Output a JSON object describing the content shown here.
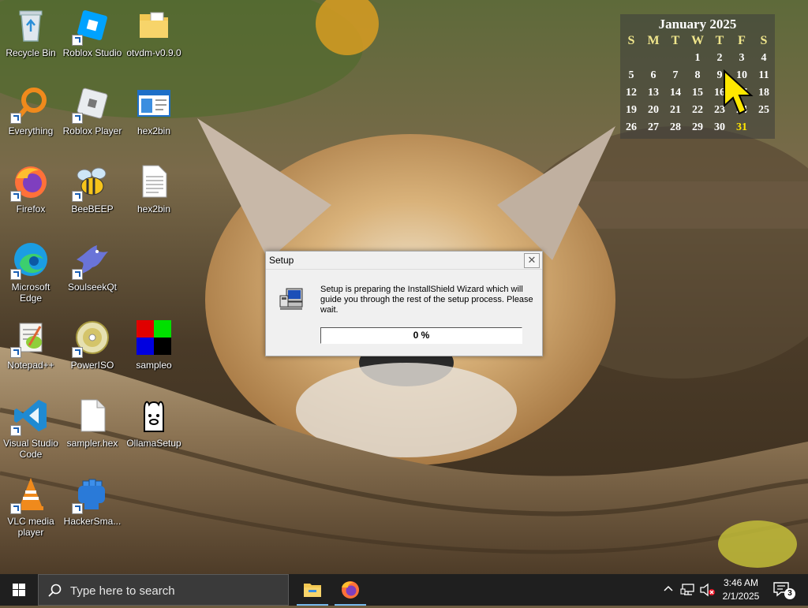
{
  "desktop": {
    "icons": [
      {
        "label": "Recycle Bin",
        "icon": "recycle-bin-icon"
      },
      {
        "label": "Roblox Studio",
        "icon": "roblox-studio-icon"
      },
      {
        "label": "otvdm-v0.9.0",
        "icon": "folder-icon"
      },
      {
        "label": "Everything",
        "icon": "everything-search-icon"
      },
      {
        "label": "Roblox Player",
        "icon": "roblox-player-icon"
      },
      {
        "label": "hex2bin",
        "icon": "window-app-icon"
      },
      {
        "label": "Firefox",
        "icon": "firefox-icon"
      },
      {
        "label": "BeeBEEP",
        "icon": "bee-icon"
      },
      {
        "label": "hex2bin",
        "icon": "text-file-icon"
      },
      {
        "label": "Microsoft Edge",
        "icon": "edge-icon"
      },
      {
        "label": "SoulseekQt",
        "icon": "bird-icon"
      },
      {
        "label": "Notepad++",
        "icon": "notepadpp-icon"
      },
      {
        "label": "PowerISO",
        "icon": "disc-icon"
      },
      {
        "label": "sampleo",
        "icon": "color-grid-icon"
      },
      {
        "label": "Visual Studio Code",
        "icon": "vscode-icon"
      },
      {
        "label": "sampler.hex",
        "icon": "blank-file-icon"
      },
      {
        "label": "OllamaSetup",
        "icon": "llama-icon"
      },
      {
        "label": "VLC media player",
        "icon": "vlc-icon"
      },
      {
        "label": "HackerSma...",
        "icon": "fist-icon"
      }
    ]
  },
  "calendar": {
    "title": "January 2025",
    "weekdays": [
      "S",
      "M",
      "T",
      "W",
      "T",
      "F",
      "S"
    ],
    "weeks": [
      [
        "",
        "",
        "",
        "1",
        "2",
        "3",
        "4"
      ],
      [
        "5",
        "6",
        "7",
        "8",
        "9",
        "10",
        "11"
      ],
      [
        "12",
        "13",
        "14",
        "15",
        "16",
        "17",
        "18"
      ],
      [
        "19",
        "20",
        "21",
        "22",
        "23",
        "24",
        "25"
      ],
      [
        "26",
        "27",
        "28",
        "29",
        "30",
        "31",
        ""
      ]
    ],
    "today": "31",
    "highlight_color": "#ffe600"
  },
  "dialog": {
    "title": "Setup",
    "close_label": "✕",
    "message": "Setup is preparing the InstallShield Wizard which will guide you through the rest of the setup process.  Please wait.",
    "progress_fraction": 0,
    "progress_text": "0 %"
  },
  "taskbar": {
    "search_placeholder": "Type here to search",
    "pinned": [
      "file-explorer-icon",
      "firefox-icon"
    ],
    "clock_time": "3:46 AM",
    "clock_date": "2/1/2025",
    "notification_count": "3",
    "accent_color": "#76b9ed"
  }
}
